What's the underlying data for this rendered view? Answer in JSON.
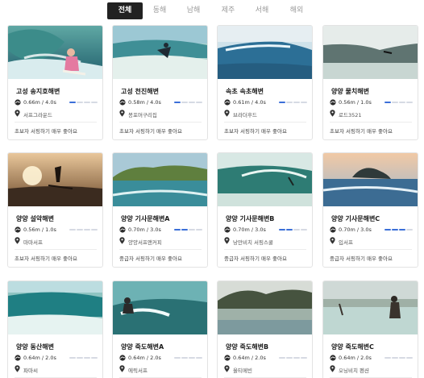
{
  "tabs": [
    {
      "label": "전체",
      "active": true
    },
    {
      "label": "동해",
      "active": false
    },
    {
      "label": "남해",
      "active": false
    },
    {
      "label": "제주",
      "active": false
    },
    {
      "label": "서해",
      "active": false
    },
    {
      "label": "해외",
      "active": false
    }
  ],
  "colors": {
    "active_tab_bg": "#222222",
    "level_bar_filled": "#3b6fd8",
    "level_bar_empty": "#d6dae3"
  },
  "spots": [
    {
      "name": "고성 송지호해변",
      "wave": "0.66m / 4.0s",
      "level": 1,
      "shop": "서프그라운드",
      "desc": "초보자 서핑하기 매우 좋아요",
      "photo": "surfer-woman"
    },
    {
      "name": "고성 천진해변",
      "wave": "0.58m / 4.0s",
      "level": 1,
      "shop": "봉포머구리집",
      "desc": "초보자 서핑하기 매우 좋아요",
      "photo": "surfer-turn"
    },
    {
      "name": "속초 속초해변",
      "wave": "0.61m / 4.0s",
      "level": 1,
      "shop": "브라더후드",
      "desc": "초보자 서핑하기 매우 좋아요",
      "photo": "blue-wave"
    },
    {
      "name": "양양 물치해변",
      "wave": "0.56m / 1.0s",
      "level": 1,
      "shop": "로드3521",
      "desc": "초보자 서핑하기 매우 좋아요",
      "photo": "grey-wave"
    },
    {
      "name": "양양 설악해변",
      "wave": "0.56m / 1.0s",
      "level": 0,
      "shop": "마마서프",
      "desc": "초보자 서핑하기 매우 좋아요",
      "photo": "sunset"
    },
    {
      "name": "양양 기사문해변A",
      "wave": "0.70m / 3.0s",
      "level": 2,
      "shop": "양양서프앤커피",
      "desc": "중급자 서핑하기 매우 좋아요",
      "photo": "island-rocks"
    },
    {
      "name": "양양 기사문해변B",
      "wave": "0.70m / 3.0s",
      "level": 2,
      "shop": "낭만비치 서핑스쿨",
      "desc": "중급자 서핑하기 매우 좋아요",
      "photo": "green-barrel"
    },
    {
      "name": "양양 기사문해변C",
      "wave": "0.70m / 3.0s",
      "level": 3,
      "shop": "입서프",
      "desc": "중급자 서핑하기 매우 좋아요",
      "photo": "island-sunset"
    },
    {
      "name": "양양 동산해변",
      "wave": "0.64m / 2.0s",
      "level": 0,
      "shop": "파마씨",
      "desc": "",
      "photo": "teal-wave"
    },
    {
      "name": "양양 죽도해변A",
      "wave": "0.64m / 2.0s",
      "level": 0,
      "shop": "에릭서프",
      "desc": "",
      "photo": "surfer-spray"
    },
    {
      "name": "양양 죽도해변B",
      "wave": "0.64m / 2.0s",
      "level": 0,
      "shop": "올티메빈",
      "desc": "",
      "photo": "hills-beach"
    },
    {
      "name": "양양 죽도해변C",
      "wave": "0.64m / 2.0s",
      "level": 0,
      "shop": "오닝비치 펜션",
      "desc": "",
      "photo": "surfers-shore"
    }
  ]
}
